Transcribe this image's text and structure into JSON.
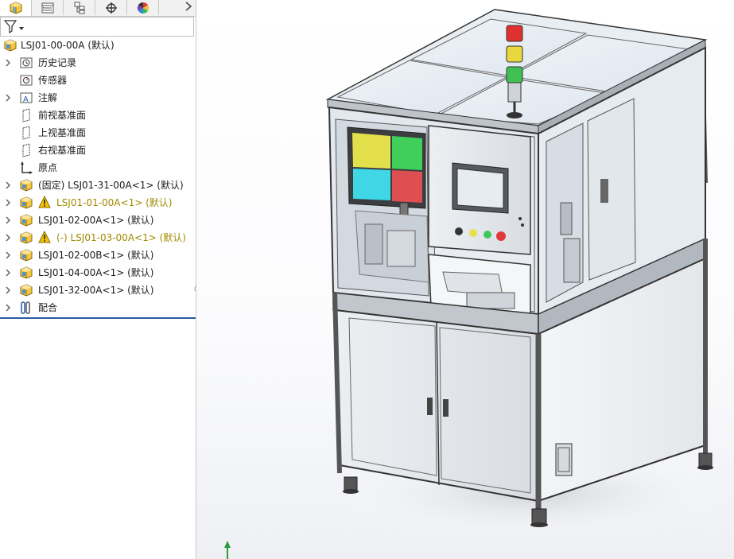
{
  "panel": {
    "tabs": [
      {
        "name": "feature-manager",
        "icon": "feature-manager-icon"
      },
      {
        "name": "property-manager",
        "icon": "property-manager-icon"
      },
      {
        "name": "configuration-manager",
        "icon": "configuration-manager-icon"
      },
      {
        "name": "dimxpert-manager",
        "icon": "crosshair-icon"
      },
      {
        "name": "display-manager",
        "icon": "color-wheel-icon"
      }
    ],
    "filter_icon": "funnel-filter-icon",
    "tree": {
      "root": {
        "label": "LSJ01-00-00A  (默认)",
        "icon": "assembly-icon"
      },
      "items": [
        {
          "label": "历史记录",
          "icon": "history-icon",
          "expandable": true,
          "warn": false
        },
        {
          "label": "传感器",
          "icon": "sensor-icon",
          "expandable": false,
          "warn": false
        },
        {
          "label": "注解",
          "icon": "annotation-icon",
          "expandable": true,
          "warn": false
        },
        {
          "label": "前视基准面",
          "icon": "plane-icon",
          "expandable": false,
          "warn": false
        },
        {
          "label": "上视基准面",
          "icon": "plane-icon",
          "expandable": false,
          "warn": false
        },
        {
          "label": "右视基准面",
          "icon": "plane-icon",
          "expandable": false,
          "warn": false
        },
        {
          "label": "原点",
          "icon": "origin-icon",
          "expandable": false,
          "warn": false
        },
        {
          "label": "(固定) LSJ01-31-00A<1> (默认)",
          "icon": "subassembly-icon",
          "expandable": true,
          "warn": false
        },
        {
          "label": "LSJ01-01-00A<1> (默认)",
          "icon": "subassembly-icon",
          "expandable": true,
          "warn": true
        },
        {
          "label": "LSJ01-02-00A<1> (默认)",
          "icon": "subassembly-icon",
          "expandable": true,
          "warn": false
        },
        {
          "label": "(-) LSJ01-03-00A<1> (默认)",
          "icon": "subassembly-icon",
          "expandable": true,
          "warn": true
        },
        {
          "label": "LSJ01-02-00B<1> (默认)",
          "icon": "subassembly-icon",
          "expandable": true,
          "warn": false
        },
        {
          "label": "LSJ01-04-00A<1> (默认)",
          "icon": "subassembly-icon",
          "expandable": true,
          "warn": false
        },
        {
          "label": "LSJ01-32-00A<1> (默认)",
          "icon": "subassembly-icon",
          "expandable": true,
          "warn": false
        },
        {
          "label": "配合",
          "icon": "mates-icon",
          "expandable": true,
          "warn": false
        }
      ]
    }
  },
  "viewport": {
    "model": "machine-enclosure-assembly",
    "hmi_lights": [
      "#e8e04a",
      "#3dc95a",
      "#e03a3a"
    ],
    "stack_light": [
      "#e03030",
      "#e8d840",
      "#40c050"
    ],
    "monitor_colors": [
      "#e4e04c",
      "#3fcf5a",
      "#3fd6e6",
      "#de4f52"
    ],
    "triad_icon": "coordinate-triad-icon"
  }
}
